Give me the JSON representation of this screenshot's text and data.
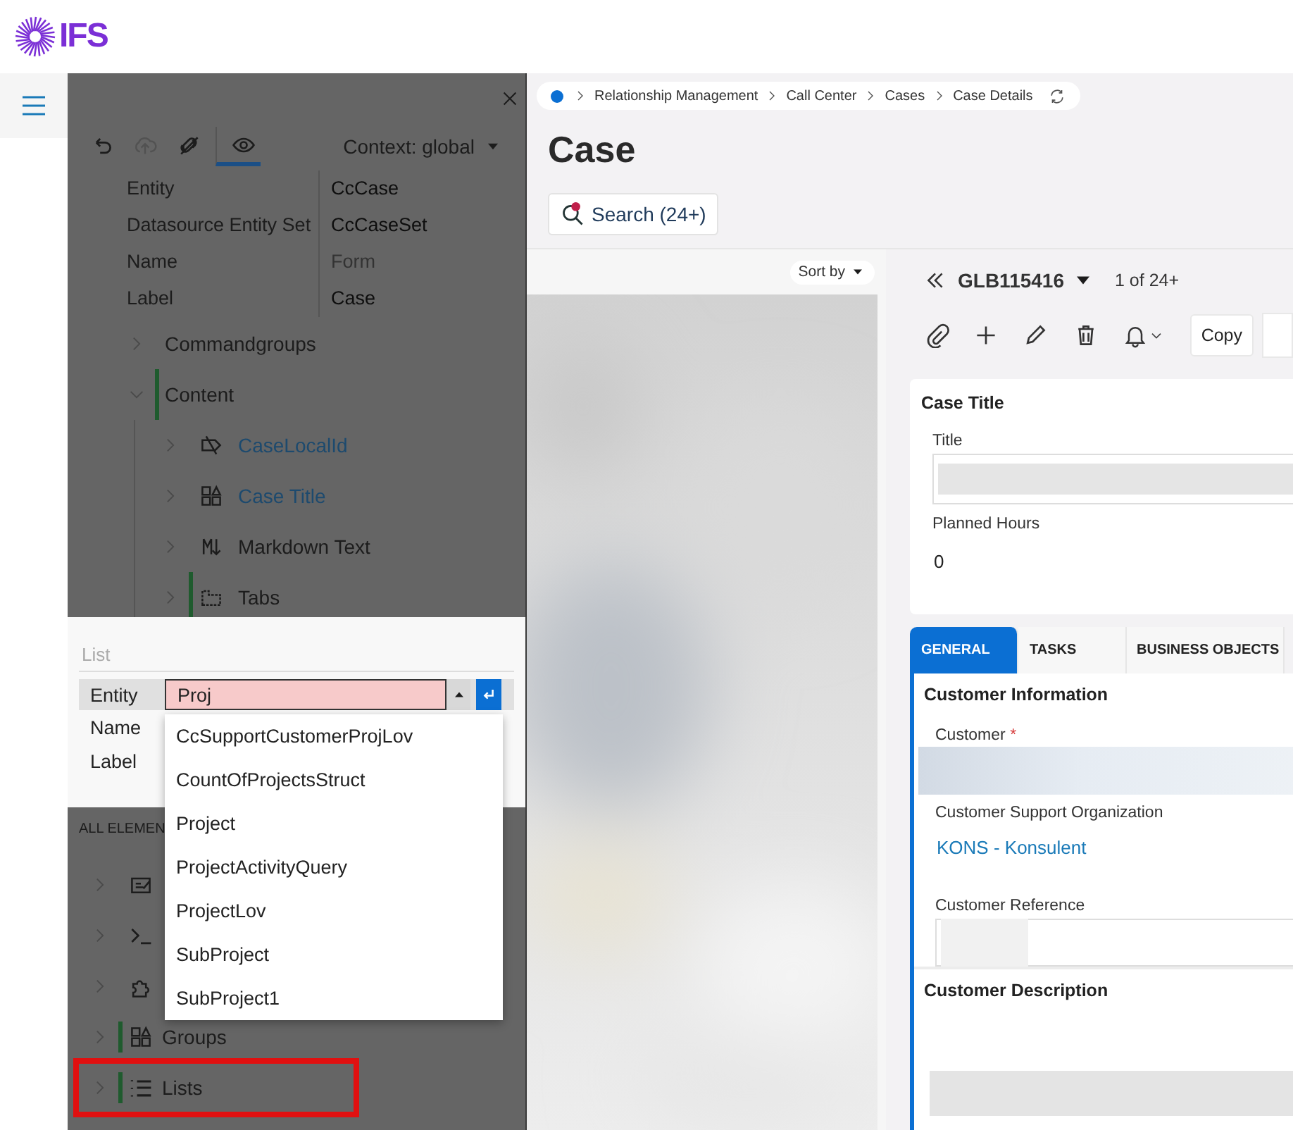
{
  "header": {
    "logo_text": "IFS"
  },
  "designer": {
    "tools": [
      {
        "kind": "undo",
        "selected": false,
        "disabled": false
      },
      {
        "kind": "upload",
        "selected": false,
        "disabled": true
      },
      {
        "kind": "unlink",
        "selected": false,
        "disabled": false
      },
      {
        "kind": "eye",
        "selected": true,
        "disabled": false
      }
    ],
    "context": "Context: global",
    "properties": [
      {
        "label": "Entity",
        "value": "CcCase",
        "muted": false
      },
      {
        "label": "Datasource Entity Set",
        "value": "CcCaseSet",
        "muted": false
      },
      {
        "label": "Name",
        "value": "Form",
        "muted": true
      },
      {
        "label": "Label",
        "value": "Case",
        "muted": false
      }
    ],
    "tree": [
      {
        "label": "Commandgroups",
        "expanded": false,
        "marked": false,
        "link": false
      },
      {
        "label": "Content",
        "expanded": true,
        "marked": true,
        "link": false,
        "children": [
          {
            "label": "CaseLocalId",
            "kind": "tag",
            "expanded": false,
            "marked": false,
            "link": true
          },
          {
            "label": "Case Title",
            "kind": "shapes",
            "expanded": false,
            "marked": false,
            "link": true
          },
          {
            "label": "Markdown Text",
            "kind": "markdown",
            "expanded": false,
            "marked": false,
            "link": false
          },
          {
            "label": "Tabs",
            "kind": "tabs",
            "expanded": false,
            "marked": true,
            "link": false
          }
        ]
      }
    ],
    "list_editor": {
      "title": "List",
      "fields": [
        {
          "label": "Entity",
          "value": "Proj",
          "invalid": true
        },
        {
          "label": "Name"
        },
        {
          "label": "Label"
        }
      ],
      "suggestions": [
        "CcSupportCustomerProjLov",
        "CountOfProjectsStruct",
        "Project",
        "ProjectActivityQuery",
        "ProjectLov",
        "SubProject",
        "SubProject1"
      ]
    },
    "all_elements": {
      "heading": "ALL ELEMEN",
      "items": [
        {
          "kind": "form",
          "marked": false,
          "highlighted": false
        },
        {
          "kind": "command",
          "marked": false,
          "highlighted": false
        },
        {
          "kind": "puzzle",
          "marked": false,
          "highlighted": false
        },
        {
          "label": "Groups",
          "kind": "shapes",
          "marked": true,
          "highlighted": false
        },
        {
          "label": "Lists",
          "kind": "list",
          "marked": true,
          "highlighted": true
        }
      ]
    }
  },
  "page": {
    "breadcrumb": [
      "Relationship Management",
      "Call Center",
      "Cases",
      "Case Details"
    ],
    "title": "Case",
    "search": "Search (24+)",
    "sort": "Sort by",
    "record": {
      "id": "GLB115416",
      "position": "1 of 24+"
    },
    "actions": [
      {
        "kind": "attach"
      },
      {
        "kind": "add"
      },
      {
        "kind": "edit"
      },
      {
        "kind": "delete"
      },
      {
        "kind": "notify"
      },
      {
        "kind": "text",
        "label": "Copy"
      }
    ],
    "card": {
      "title": "Case Title",
      "fields": [
        {
          "label": "Title",
          "kind": "input"
        },
        {
          "label": "Planned Hours",
          "kind": "text",
          "value": "0"
        }
      ]
    },
    "tabs": [
      {
        "label": "GENERAL",
        "selected": true
      },
      {
        "label": "TASKS",
        "selected": false
      },
      {
        "label": "BUSINESS OBJECTS",
        "selected": false
      }
    ],
    "sections": [
      {
        "title": "Customer Information",
        "fields": [
          {
            "label": "Customer",
            "required_mark": "*",
            "kind": "input"
          },
          {
            "label": "Customer Support Organization",
            "kind": "link",
            "value": "KONS - Konsulent"
          },
          {
            "label": "Customer Reference",
            "kind": "input"
          }
        ]
      },
      {
        "title": "Customer Description",
        "fields": [
          {
            "kind": "area"
          }
        ]
      }
    ]
  }
}
